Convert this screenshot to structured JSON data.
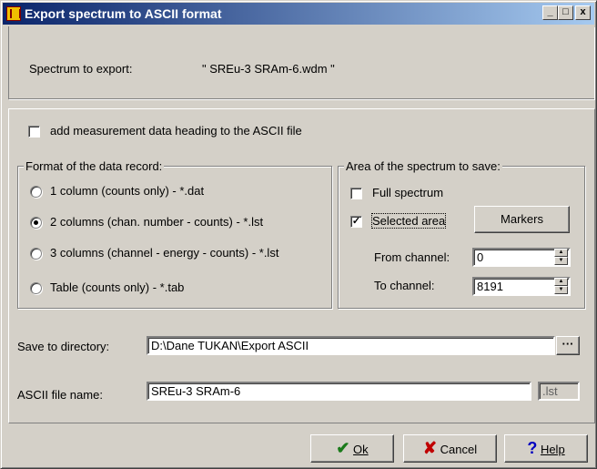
{
  "window": {
    "title": "Export spectrum to ASCII format",
    "minimize": "_",
    "maximize": "□",
    "close": "x"
  },
  "spectrum": {
    "label": "Spectrum to export:",
    "value": "\" SREu-3 SRAm-6.wdm \""
  },
  "heading_checkbox": {
    "label": "add measurement data heading to the ASCII file",
    "checked": false
  },
  "format": {
    "legend": "Format of the data record:",
    "options": [
      {
        "label": "1 column (counts only) - *.dat",
        "selected": false
      },
      {
        "label": "2 columns (chan. number - counts) - *.lst",
        "selected": true
      },
      {
        "label": "3 columns (channel - energy - counts) - *.lst",
        "selected": false
      },
      {
        "label": "Table (counts only) - *.tab",
        "selected": false
      }
    ]
  },
  "area": {
    "legend": "Area of the spectrum to save:",
    "full_spectrum": {
      "label": "Full spectrum",
      "checked": false
    },
    "selected_area": {
      "label": "Selected area",
      "checked": true
    },
    "markers_button": "Markers",
    "from_channel": {
      "label": "From channel:",
      "value": "0"
    },
    "to_channel": {
      "label": "To channel:",
      "value": "8191"
    }
  },
  "directory": {
    "label": "Save to directory:",
    "value": "D:\\Dane TUKAN\\Export ASCII",
    "browse": "···"
  },
  "filename": {
    "label": "ASCII file name:",
    "value": "SREu-3 SRAm-6",
    "extension": ".lst"
  },
  "buttons": {
    "ok": "Ok",
    "cancel": "Cancel",
    "help": "Help"
  },
  "colors": {
    "ok_check": "#1a7a1a",
    "cancel_x": "#c00000",
    "help_q": "#0000c0"
  }
}
